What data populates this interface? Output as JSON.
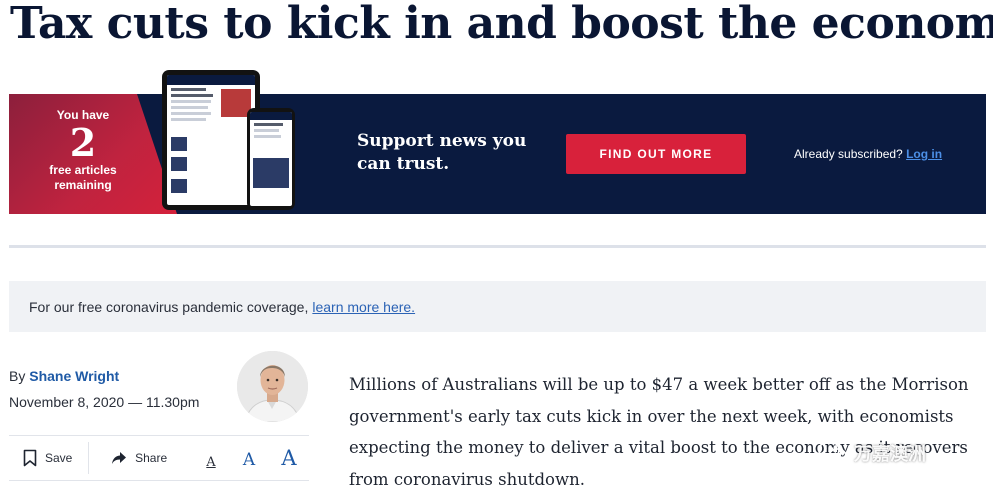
{
  "article": {
    "headline": "Tax cuts to kick in and boost the economy",
    "byline_prefix": "By",
    "author": "Shane Wright",
    "date": "November 8, 2020 — 11.30pm",
    "body": "Millions of Australians will be up to $47 a week better off as the Morrison government's early tax cuts kick in over the next week, with economists expecting the money to deliver a vital boost to the economy as it recovers from coronavirus shutdown."
  },
  "banner": {
    "you_have": "You have",
    "count": "2",
    "remaining": "free articles remaining",
    "tagline": "Support news you can trust.",
    "cta_label": "FIND OUT MORE",
    "subscribed_text": "Already subscribed?",
    "login_label": "Log in"
  },
  "notice": {
    "text": "For our free coronavirus pandemic coverage,",
    "link": "learn more here."
  },
  "toolbar": {
    "save_label": "Save",
    "share_label": "Share",
    "size_small": "A",
    "size_medium": "A",
    "size_large": "A"
  },
  "watermark": {
    "text": "万嘉澳洲"
  },
  "colors": {
    "navy": "#0a1a3f",
    "accent_red": "#d8213b",
    "link_blue": "#1f5aa6"
  },
  "icons": [
    "bookmark-icon",
    "share-arrow-icon",
    "wechat-icon"
  ]
}
